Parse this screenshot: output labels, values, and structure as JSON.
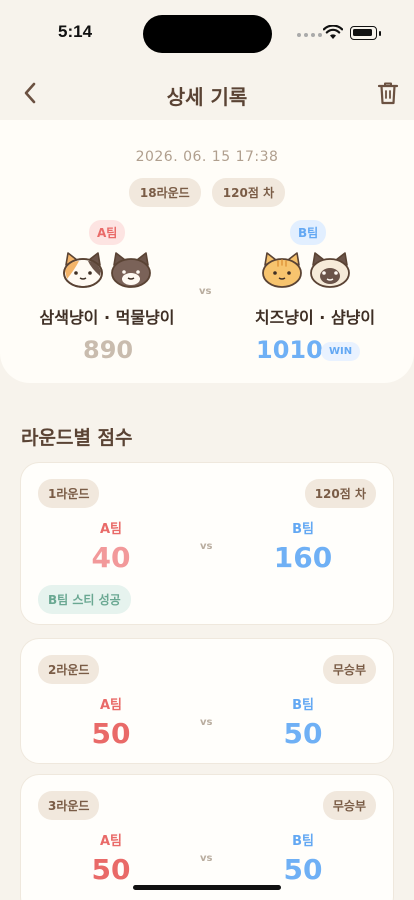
{
  "status": {
    "time": "5:14"
  },
  "nav": {
    "title": "상세 기록",
    "back_icon": "chevron-left-icon",
    "delete_icon": "trash-icon"
  },
  "summary": {
    "datetime": "2026. 06. 15 17:38",
    "rounds_pill": "18라운드",
    "diff_pill": "120점 차",
    "vs": "vs",
    "team_a": {
      "tag": "A팀",
      "name": "삼색냥이 · 먹물냥이",
      "score": "890",
      "score_color": "#c9bcae"
    },
    "team_b": {
      "tag": "B팀",
      "name": "치즈냥이 · 샴냥이",
      "score": "1010",
      "score_color": "#6fb0f5",
      "win": "WIN"
    }
  },
  "section": {
    "title": "라운드별 점수"
  },
  "rounds": [
    {
      "label": "1라운드",
      "result": "120점 차",
      "a_label": "A팀",
      "a_score": "40",
      "b_label": "B팀",
      "b_score": "160",
      "vs": "vs",
      "badge": "B팀 스티 성공",
      "a_color": "#f2999a",
      "b_color": "#6fb0f5"
    },
    {
      "label": "2라운드",
      "result": "무승부",
      "a_label": "A팀",
      "a_score": "50",
      "b_label": "B팀",
      "b_score": "50",
      "vs": "vs",
      "a_color": "#e96a68",
      "b_color": "#6fb0f5"
    },
    {
      "label": "3라운드",
      "result": "무승부",
      "a_label": "A팀",
      "a_score": "50",
      "b_label": "B팀",
      "b_score": "50",
      "vs": "vs",
      "a_color": "#e96a68",
      "b_color": "#6fb0f5"
    }
  ]
}
